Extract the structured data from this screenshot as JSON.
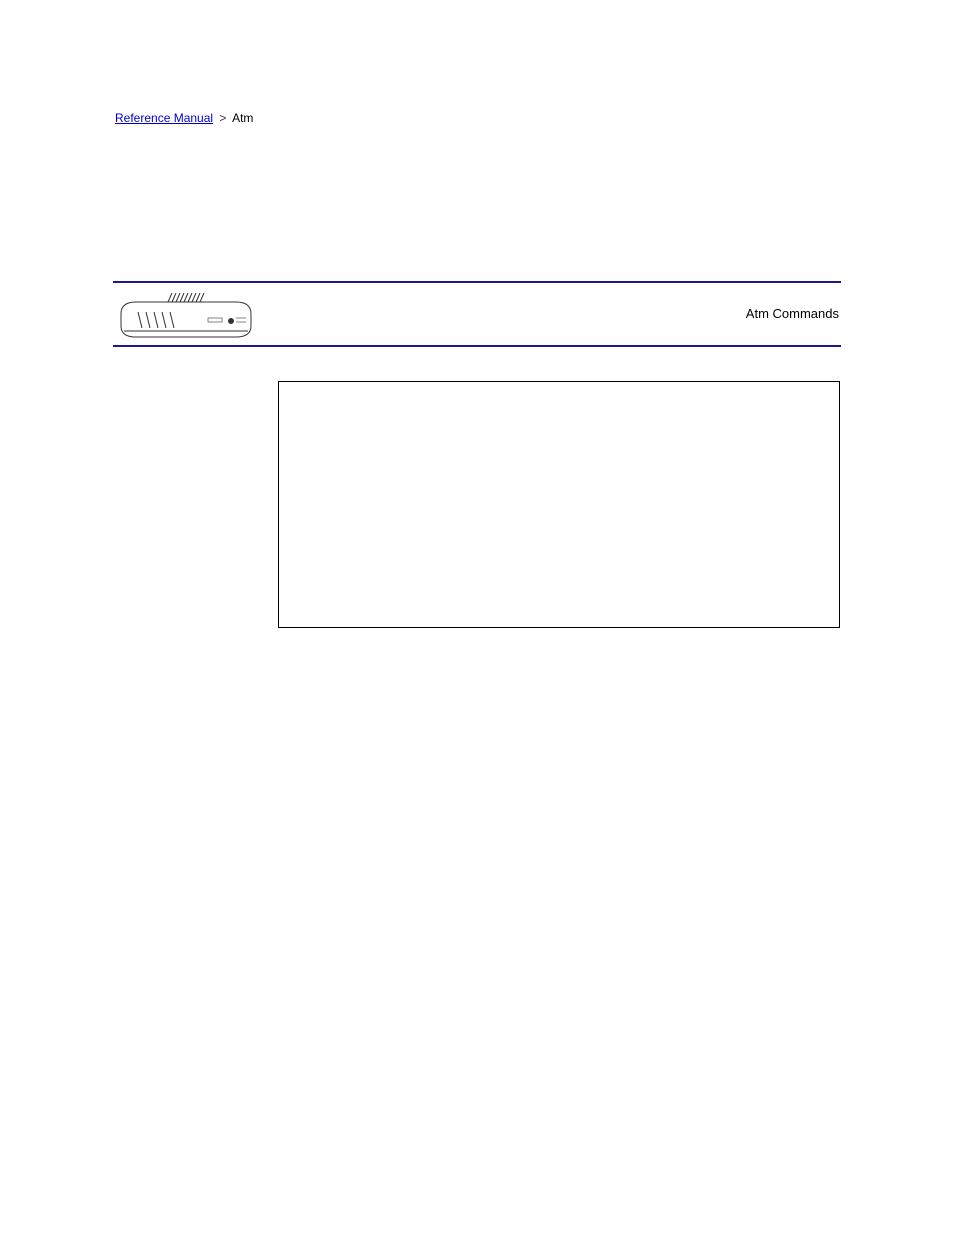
{
  "breadcrumb": {
    "link": "Reference Manual",
    "separator": ">",
    "current": "Atm"
  },
  "label": "Atm Commands"
}
